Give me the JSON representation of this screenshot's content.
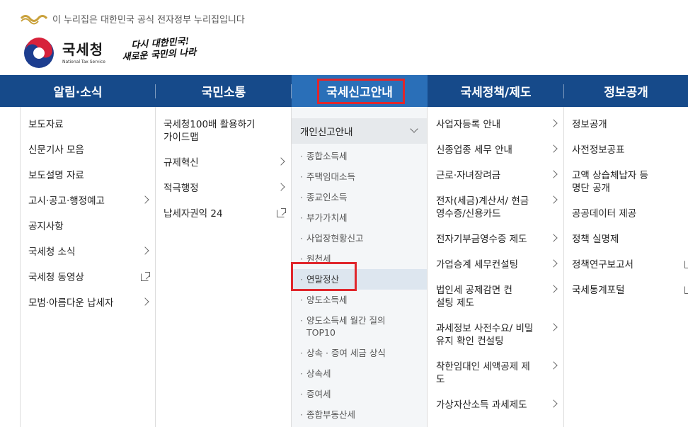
{
  "notice": {
    "text": "이 누리집은 대한민국 공식 전자정부 누리집입니다"
  },
  "logo": {
    "title": "국세청",
    "subtitle": "National Tax Service",
    "slogan_line1": "다시 대한민국!",
    "slogan_line2": "새로운 국민의 나라"
  },
  "gnb": [
    {
      "label": "알림·소식"
    },
    {
      "label": "국민소통"
    },
    {
      "label": "국세신고안내"
    },
    {
      "label": "국세정책/제도"
    },
    {
      "label": "정보공개"
    }
  ],
  "col1": [
    {
      "label": "보도자료"
    },
    {
      "label": "신문기사 모음"
    },
    {
      "label": "보도설명 자료"
    },
    {
      "label": "고시·공고·행정예고"
    },
    {
      "label": "공지사항"
    },
    {
      "label": "국세청 소식"
    },
    {
      "label": "국세청 동영상"
    },
    {
      "label": "모범·아름다운 납세자"
    }
  ],
  "col2": [
    {
      "label": "국세청100배 활용하기 가이드맵"
    },
    {
      "label": "규제혁신"
    },
    {
      "label": "적극행정"
    },
    {
      "label": "납세자권익 24"
    }
  ],
  "col3": {
    "head": "개인신고안내",
    "items": [
      {
        "label": "종합소득세"
      },
      {
        "label": "주택임대소득"
      },
      {
        "label": "종교인소득"
      },
      {
        "label": "부가가치세"
      },
      {
        "label": "사업장현황신고"
      },
      {
        "label": "원천세"
      },
      {
        "label": "연말정산"
      },
      {
        "label": "양도소득세"
      },
      {
        "label": "양도소득세 월간 질의 TOP10"
      },
      {
        "label": "상속 · 증여 세금 상식"
      },
      {
        "label": "상속세"
      },
      {
        "label": "증여세"
      },
      {
        "label": "종합부동산세"
      }
    ]
  },
  "col4": [
    {
      "label": "사업자등록 안내"
    },
    {
      "label": "신종업종 세무 안내"
    },
    {
      "label": "근로·자녀장려금"
    },
    {
      "label": "전자(세금)계산서/ 현금영수증/신용카드"
    },
    {
      "label": "전자기부금영수증 제도"
    },
    {
      "label": "가업승계 세무컨설팅"
    },
    {
      "label": "법인세 공제감면 컨설팅 제도"
    },
    {
      "label": "과세정보 사전수요/ 비밀유지 확인 컨설팅"
    },
    {
      "label": "착한임대인 세액공제 제도"
    },
    {
      "label": "가상자산소득 과세제도"
    }
  ],
  "col5": [
    {
      "label": "정보공개"
    },
    {
      "label": "사전정보공표"
    },
    {
      "label": "고액 상습체납자 등 명단 공개"
    },
    {
      "label": "공공데이터 제공"
    },
    {
      "label": "정책 실명제"
    },
    {
      "label": "정책연구보고서"
    },
    {
      "label": "국세통계포털"
    }
  ],
  "colors": {
    "gnb_bg": "#164a8a",
    "gnb_active": "#2a6fb8",
    "highlight": "#e0262c"
  }
}
